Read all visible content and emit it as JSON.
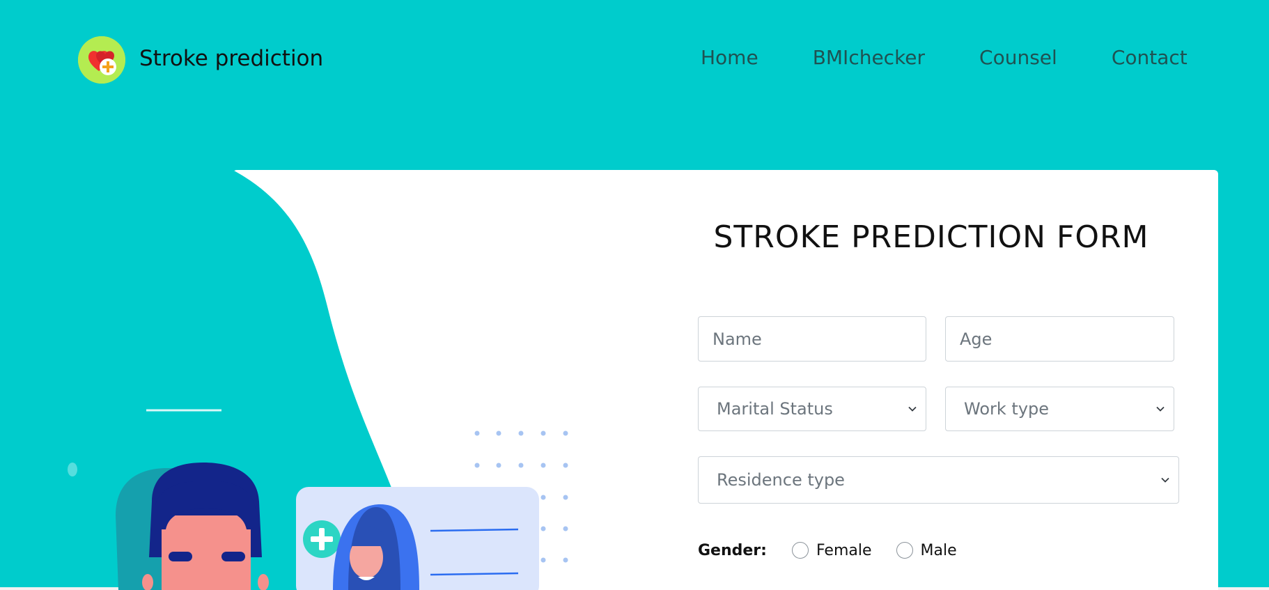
{
  "brand": {
    "name": "Stroke prediction",
    "logo_icon": "heart-plus-icon"
  },
  "nav": {
    "items": [
      {
        "label": "Home"
      },
      {
        "label": "BMIchecker"
      },
      {
        "label": "Counsel"
      },
      {
        "label": "Contact"
      }
    ]
  },
  "form": {
    "title": "STROKE PREDICTION FORM",
    "name_placeholder": "Name",
    "age_placeholder": "Age",
    "marital_status": "Marital Status",
    "work_type": "Work type",
    "residence_type": "Residence type",
    "gender_label": "Gender:",
    "gender_options": [
      "Female",
      "Male"
    ]
  },
  "colors": {
    "background": "#00cccc",
    "logo": "#b4ec51",
    "nav_text": "#1f5252"
  }
}
